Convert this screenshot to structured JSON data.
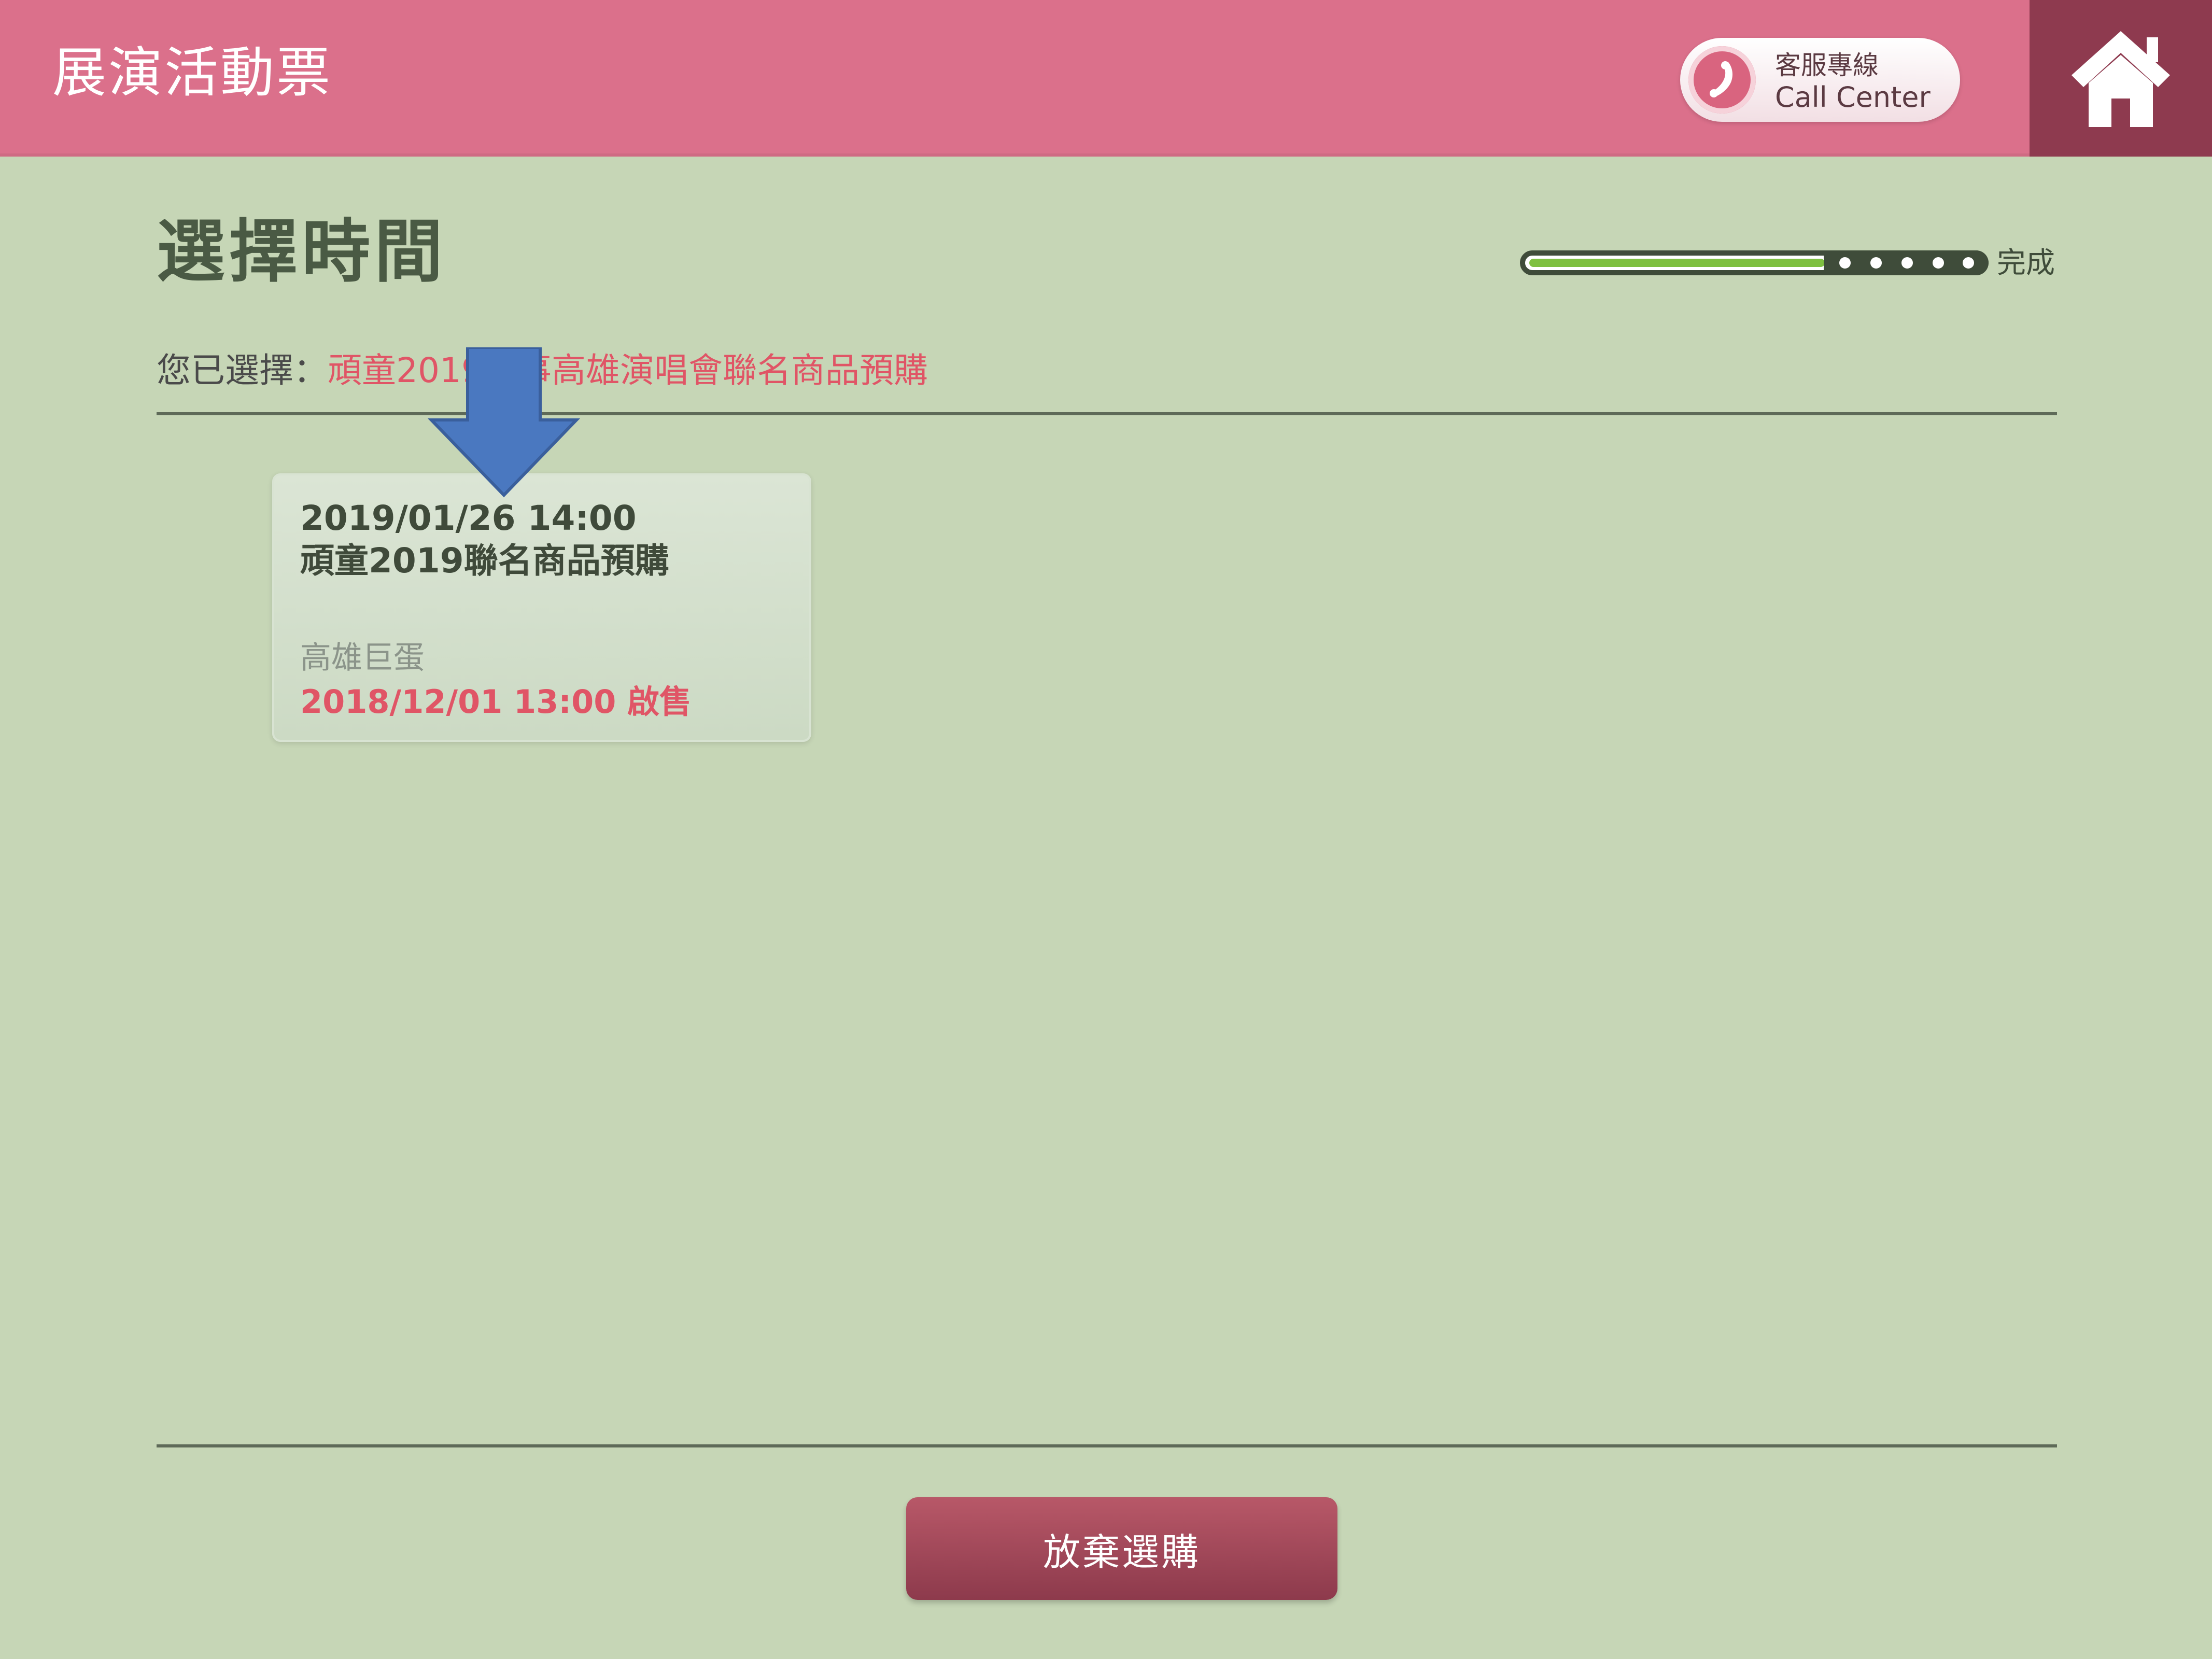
{
  "header": {
    "title": "展演活動票",
    "call_center_zh": "客服專線",
    "call_center_en": "Call Center",
    "background_color": "#db708b",
    "home_tile_color": "#8e3a4f"
  },
  "page": {
    "title": "選擇時間",
    "progress_label": "完成",
    "progress_fraction": 0.66
  },
  "selection": {
    "label": "您已選擇：",
    "value": "頑童2019大事高雄演唱會聯名商品預購"
  },
  "sessions": [
    {
      "datetime": "2019/01/26 14:00",
      "name": "頑童2019聯名商品預購",
      "venue": "高雄巨蛋",
      "sale": "2018/12/01 13:00 啟售"
    }
  ],
  "actions": {
    "abandon_label": "放棄選購"
  },
  "colors": {
    "page_background": "#c6d6b6",
    "accent_red": "#e05566",
    "button": "#8d3a4c",
    "progress_fill": "#7ec040",
    "annotation_arrow": "#4a78c0"
  },
  "icons": {
    "phone": "phone-icon",
    "home": "home-icon",
    "arrow": "arrow-down-icon"
  }
}
